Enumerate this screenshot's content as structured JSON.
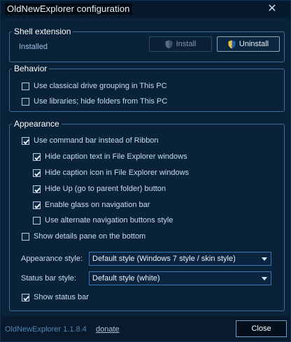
{
  "window": {
    "title": "OldNewExplorer configuration",
    "close_glyph": "✕"
  },
  "shell_extension": {
    "legend": "Shell extension",
    "status": "Installed",
    "install_label": "Install",
    "install_enabled": false,
    "uninstall_label": "Uninstall",
    "shield_icon": "uac-shield-icon"
  },
  "behavior": {
    "legend": "Behavior",
    "options": [
      {
        "label": "Use classical drive grouping in This PC",
        "checked": false
      },
      {
        "label": "Use libraries; hide folders from This PC",
        "checked": false
      }
    ]
  },
  "appearance": {
    "legend": "Appearance",
    "use_command_bar": {
      "label": "Use command bar instead of Ribbon",
      "checked": true
    },
    "sub_options": [
      {
        "label": "Hide caption text in File Explorer windows",
        "checked": true
      },
      {
        "label": "Hide caption icon in File Explorer windows",
        "checked": true
      },
      {
        "label": "Hide Up (go to parent folder) button",
        "checked": true
      },
      {
        "label": "Enable glass on navigation bar",
        "checked": true
      },
      {
        "label": "Use alternate navigation buttons style",
        "checked": false
      }
    ],
    "details_pane": {
      "label": "Show details pane on the bottom",
      "checked": false
    },
    "appearance_style": {
      "label": "Appearance style:",
      "value": "Default style (Windows 7 style / skin style)"
    },
    "status_bar_style": {
      "label": "Status bar style:",
      "value": "Default style (white)"
    },
    "show_status_bar": {
      "label": "Show status bar",
      "checked": true
    }
  },
  "footer": {
    "version": "OldNewExplorer 1.1.8.4",
    "donate_label": "donate",
    "close_label": "Close"
  },
  "colors": {
    "background": "#0a2238",
    "accent": "#3a78b5",
    "text": "#c6dcef"
  }
}
